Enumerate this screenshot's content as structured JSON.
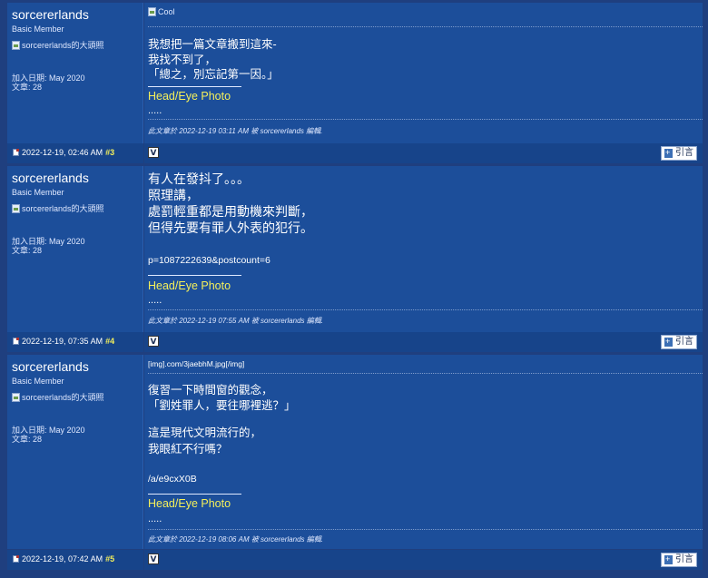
{
  "posts": [
    {
      "username": "sorcererlands",
      "user_title": "Basic Member",
      "avatar_alt": "sorcererlands的大頭照",
      "join_date": "加入日期: May 2020",
      "post_count": "文章: 28",
      "header_image_alt": "Cool",
      "body_lines": [
        "我想把一篇文章搬到這來-",
        "我找不到了，",
        "「總之，別忘記第一因。」"
      ],
      "signature_title": "Head/Eye Photo",
      "signature_dots": ".....",
      "edit_note": "此文章於 2022-12-19 03:11 AM 被 sorcererlands 編輯.",
      "footer_date": "2022-12-19, 02:46 AM",
      "footer_num": "#3",
      "quote_label": "引言",
      "icon_v": "V"
    },
    {
      "username": "sorcererlands",
      "user_title": "Basic Member",
      "avatar_alt": "sorcererlands的大頭照",
      "join_date": "加入日期: May 2020",
      "post_count": "文章: 28",
      "body_lines": [
        "有人在發抖了。。。",
        "照理講，",
        "處罰輕重都是用動機來判斷，",
        "但得先要有罪人外表的犯行。"
      ],
      "link_line": "p=1087222639&postcount=6",
      "signature_title": "Head/Eye Photo",
      "signature_dots": ".....",
      "edit_note": "此文章於 2022-12-19 07:55 AM 被 sorcererlands 編輯.",
      "footer_date": "2022-12-19, 07:35 AM",
      "footer_num": "#4",
      "quote_label": "引言",
      "icon_v": "V"
    },
    {
      "username": "sorcererlands",
      "user_title": "Basic Member",
      "avatar_alt": "sorcererlands的大頭照",
      "join_date": "加入日期: May 2020",
      "post_count": "文章: 28",
      "img_line": "[img].com/3jaebhM.jpg[/img]",
      "body_lines": [
        "復習一下時間窗的觀念，",
        "「劉姓罪人，要往哪裡逃？」",
        "",
        "這是現代文明流行的，",
        "我眼紅不行嗎？"
      ],
      "link_line": "/a/e9cxX0B",
      "signature_title": "Head/Eye Photo",
      "signature_dots": ".....",
      "edit_note": "此文章於 2022-12-19 08:06 AM 被 sorcererlands 編輯.",
      "footer_date": "2022-12-19, 07:42 AM",
      "footer_num": "#5",
      "quote_label": "引言",
      "icon_v": "V"
    }
  ]
}
